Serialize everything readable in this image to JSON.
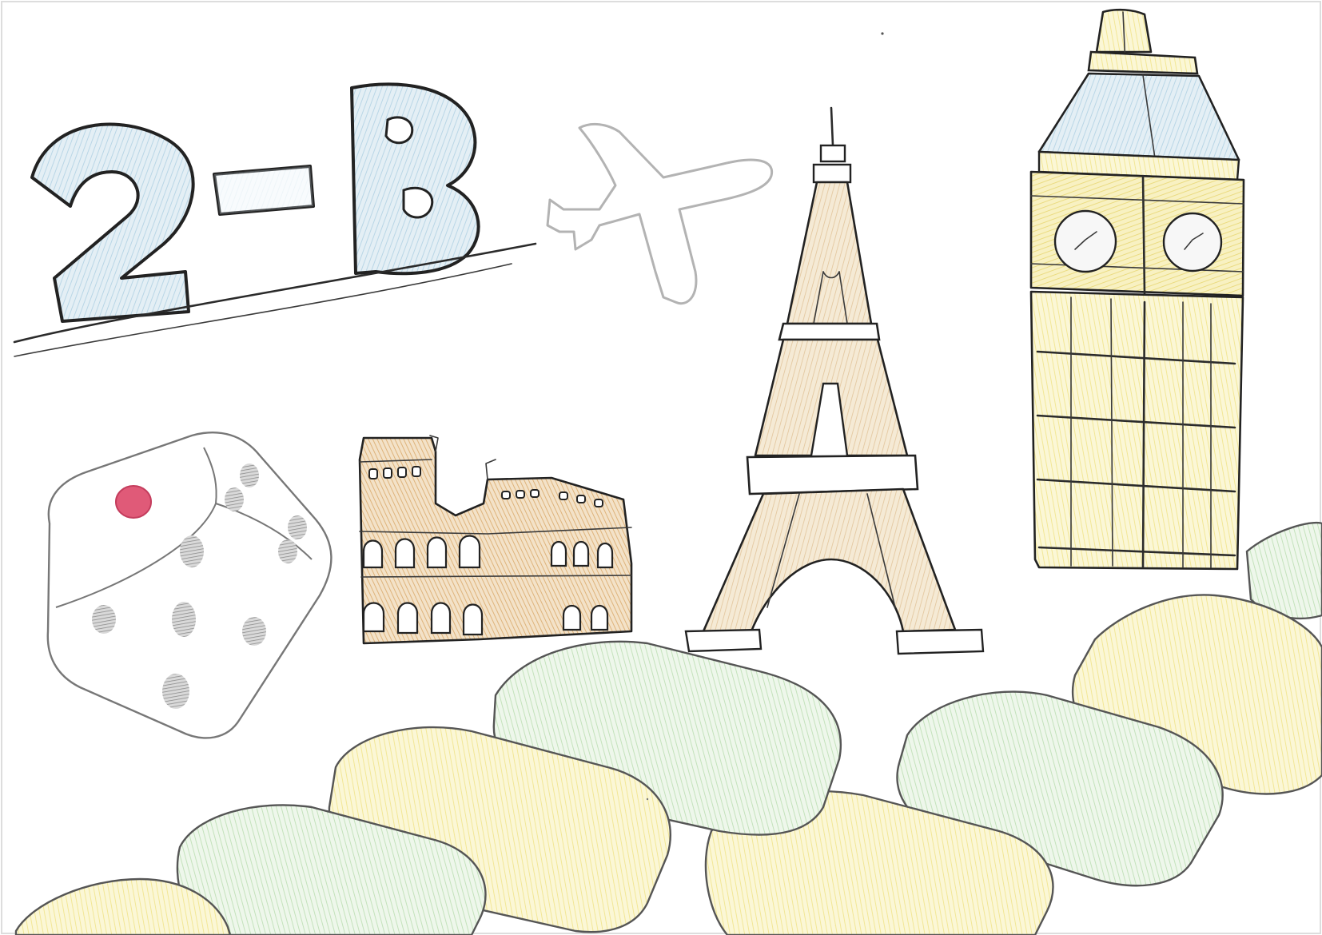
{
  "title": {
    "number": "2",
    "dash": "-",
    "letter": "B"
  },
  "colors": {
    "page": "#ffffff",
    "ink": "#2b2b2b",
    "pencil_blue": "#cfe3ee",
    "pencil_orange": "#e8c79a",
    "pencil_tan": "#ecd9b8",
    "pencil_yellow": "#f6f0b2",
    "pencil_green": "#d9ecd3",
    "pencil_red": "#e05a78",
    "pencil_gray": "#9a9a9a"
  },
  "icons": [
    "airplane-icon",
    "dice-icon",
    "colosseum-icon",
    "eiffel-tower-icon",
    "big-ben-icon",
    "board-game-path-icon"
  ]
}
